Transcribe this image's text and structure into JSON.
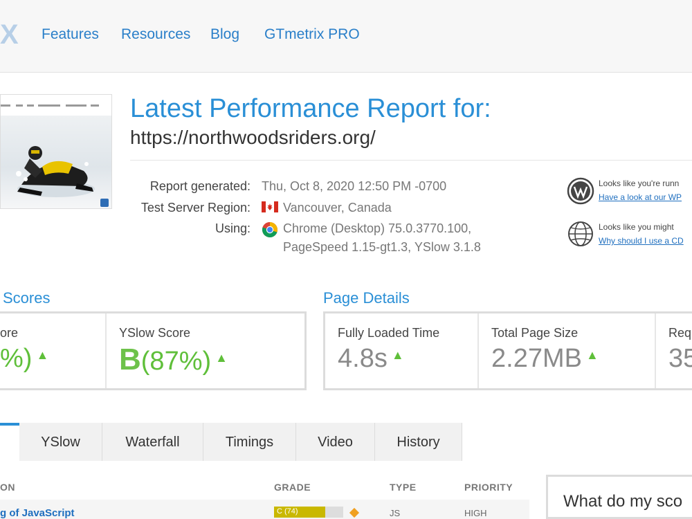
{
  "nav": {
    "logo_fragment": "X",
    "links": [
      "Features",
      "Resources",
      "Blog",
      "GTmetrix PRO"
    ]
  },
  "header": {
    "title": "Latest Performance Report for:",
    "url": "https://northwoodsriders.org/"
  },
  "report_meta": {
    "generated_label": "Report generated:",
    "generated_value": "Thu, Oct 8, 2020 12:50 PM -0700",
    "region_label": "Test Server Region:",
    "region_value": "Vancouver, Canada",
    "using_label": "Using:",
    "using_value_line1": "Chrome (Desktop) 75.0.3770.100,",
    "using_value_line2": "PageSpeed 1.15-gt1.3, YSlow 3.1.8"
  },
  "notices": [
    {
      "text": "Looks like you're runn",
      "link": "Have a look at our WP",
      "icon": "wordpress-icon"
    },
    {
      "text": "Looks like you might ",
      "link": "Why should I use a CD",
      "icon": "globe-icon"
    }
  ],
  "scores": {
    "section_title": "Scores",
    "pagespeed_label": "ore",
    "pagespeed_value": "%)",
    "yslow_label": "YSlow Score",
    "yslow_grade": "B",
    "yslow_value": "(87%)"
  },
  "page_details": {
    "section_title": "Page Details",
    "load_label": "Fully Loaded Time",
    "load_value": "4.8s",
    "size_label": "Total Page Size",
    "size_value": "2.27MB",
    "requests_label": "Requ",
    "requests_value": "35"
  },
  "tabs": [
    "YSlow",
    "Waterfall",
    "Timings",
    "Video",
    "History"
  ],
  "table": {
    "headers": {
      "name": "ON",
      "grade": "GRADE",
      "type": "TYPE",
      "priority": "PRIORITY"
    },
    "rows": [
      {
        "name": "g of JavaScript",
        "grade": "C (74)",
        "grade_pct": 74,
        "type": "JS",
        "priority": "HIGH"
      }
    ]
  },
  "help_card": {
    "text": "What do my sco"
  },
  "colors": {
    "accent": "#2a8fd6",
    "good": "#5fbf3a",
    "grade_c": "#c9b800"
  }
}
